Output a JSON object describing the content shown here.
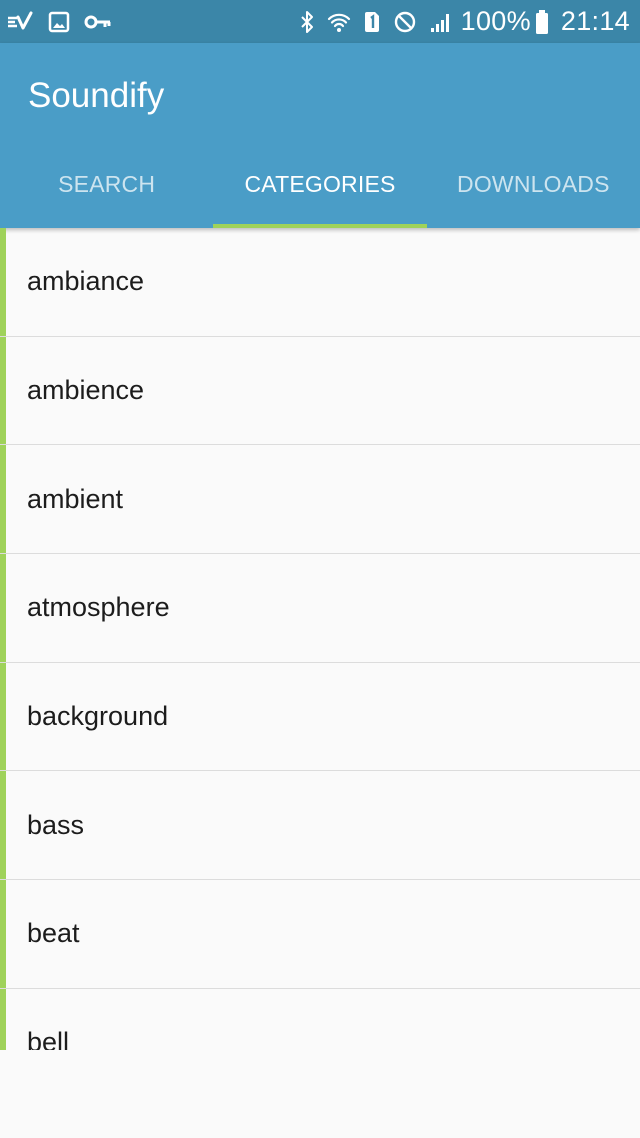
{
  "status_bar": {
    "left_icons": [
      "voicemail-check-icon",
      "image-icon",
      "key-icon"
    ],
    "right_icons": [
      "bluetooth-icon",
      "wifi-icon",
      "sim-1-icon",
      "blocked-icon",
      "signal-icon",
      "battery-icon"
    ],
    "battery": "100%",
    "time": "21:14"
  },
  "app_bar": {
    "title": "Soundify",
    "tabs": [
      {
        "label": "SEARCH",
        "active": false
      },
      {
        "label": "CATEGORIES",
        "active": true
      },
      {
        "label": "DOWNLOADS",
        "active": false
      }
    ]
  },
  "categories": [
    "ambiance",
    "ambience",
    "ambient",
    "atmosphere",
    "background",
    "bass",
    "beat",
    "bell"
  ],
  "colors": {
    "status_bar": "#3b86a8",
    "app_bar": "#4a9dc7",
    "accent": "#9fd25a",
    "list_background": "#fafafa"
  }
}
